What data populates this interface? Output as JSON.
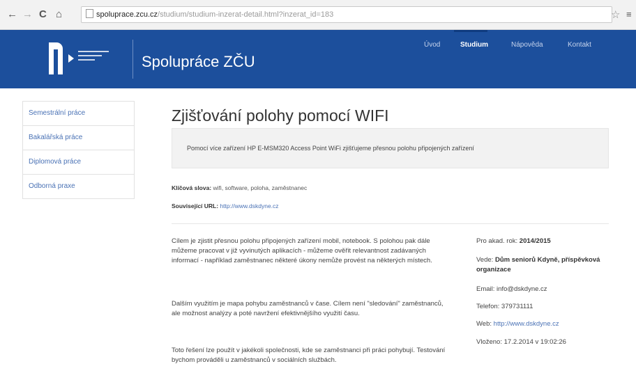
{
  "browser": {
    "back": "←",
    "forward": "→",
    "reload": "C",
    "home": "⌂",
    "url_host": "spoluprace.zcu.cz",
    "url_path": "/studium/studium-inzerat-detail.html?inzerat_id=183",
    "star": "☆",
    "menu": "≡"
  },
  "header": {
    "site_title": "Spolupráce ZČU",
    "nav": [
      "Úvod",
      "Studium",
      "Nápověda",
      "Kontakt"
    ]
  },
  "sidebar": {
    "items": [
      "Semestrální práce",
      "Bakalářská práce",
      "Diplomová práce",
      "Odborná praxe"
    ]
  },
  "main": {
    "title": "Zjišťování polohy pomocí WIFI",
    "lead": "Pomocí více zařízení HP E-MSM320 Access Point WiFi zjišťujeme přesnou polohu připojených zařízení",
    "keywords_label": "Klíčová slova:",
    "keywords_value": "wifi, software, poloha, zaměstnanec",
    "related_label": "Související URL:",
    "related_value": "http://www.dskdyne.cz",
    "paragraphs": [
      "Cílem je zjistit přesnou polohu připojených zařízení mobil, notebook. S polohou pak dále můžeme pracovat v již vyvinutých aplikacích - můžeme ověřit relevantnost zadávaných informací - například zaměstnanec některé úkony nemůže provést na některých místech.",
      "Dalším využitím je mapa pohybu zaměstnanců v čase. Cílem není \"sledování\" zaměstnanců, ale možnost analýzy a poté navržení efektivnějšího využití času.",
      "Toto řešení lze použít v jakékoli společnosti, kde se zaměstnanci při práci pohybují. Testování bychom prováděli u zaměstnanců v sociálních službách."
    ],
    "info": {
      "year_label": "Pro akad. rok:",
      "year_value": "2014/2015",
      "lead_label": "Vede:",
      "lead_value": "Dům seniorů Kdyně, příspěvková organizace",
      "email_label": "Email:",
      "email_value": "info@dskdyne.cz",
      "phone_label": "Telefon:",
      "phone_value": "379731111",
      "web_label": "Web:",
      "web_value": "http://www.dskdyne.cz",
      "inserted_label": "Vloženo:",
      "inserted_value": "17.2.2014 v 19:02:26"
    }
  }
}
